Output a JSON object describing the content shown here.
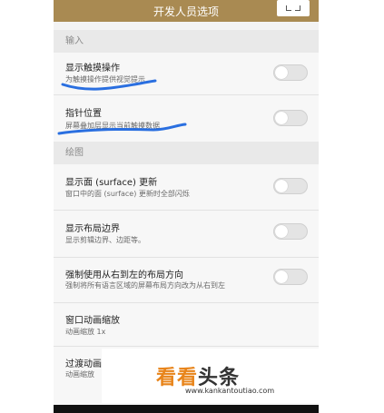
{
  "appbar": {
    "title": "开发人员选项"
  },
  "sections": {
    "input": "输入",
    "drawing": "绘图"
  },
  "rows": {
    "show_touches": {
      "title": "显示触摸操作",
      "subtitle": "为触摸操作提供视觉提示",
      "toggle_on": false
    },
    "pointer_location": {
      "title": "指针位置",
      "subtitle": "屏幕叠加层显示当前触摸数据",
      "toggle_on": false
    },
    "surface_updates": {
      "title": "显示面 (surface) 更新",
      "subtitle": "窗口中的面 (surface) 更新时全部闪烁",
      "toggle_on": false
    },
    "layout_bounds": {
      "title": "显示布局边界",
      "subtitle": "显示剪辑边界、边距等。",
      "toggle_on": false
    },
    "force_rtl": {
      "title": "强制使用从右到左的布局方向",
      "subtitle": "强制将所有语言区域的屏幕布局方向改为从右到左",
      "toggle_on": false
    },
    "window_anim": {
      "title": "窗口动画缩放",
      "subtitle": "动画缩放 1x"
    },
    "transition_anim": {
      "title": "过渡动画",
      "subtitle": "动画缩放"
    }
  },
  "watermark": {
    "logo_part1": "看看",
    "logo_part2": "头条",
    "url": "www.kankantoutiao.com"
  },
  "colors": {
    "appbar": "#a98a52",
    "scribble": "#2a6fe0",
    "logo_orange": "#e8841a"
  }
}
